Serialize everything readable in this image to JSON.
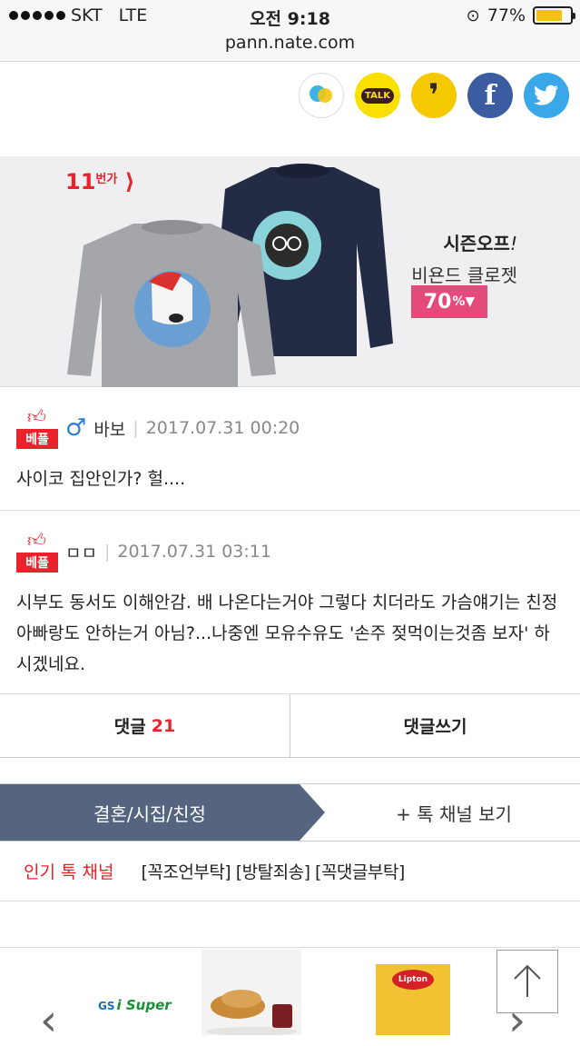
{
  "status_bar": {
    "carrier": "SKT",
    "network": "LTE",
    "time": "오전 9:18",
    "battery": "77%",
    "battery_level": 0.77,
    "url": "pann.nate.com"
  },
  "share_icons": [
    "kakaostory-icon",
    "kakaotalk-icon",
    "kakaopage-icon",
    "facebook-icon",
    "twitter-icon"
  ],
  "share": {
    "talk_label": "TALK",
    "kakaopage_glyph": "❜",
    "facebook_glyph": "f"
  },
  "ad": {
    "brand": "11",
    "brand_suffix": "번가",
    "title": "시즌오프",
    "title_mark": "!",
    "subtitle": "비욘드 클로젯",
    "discount": "70",
    "discount_unit": "%▼"
  },
  "comments": [
    {
      "badge": "베플",
      "gender_icon": "male-icon",
      "author": "바보",
      "date": "2017.07.31 00:20",
      "text": "사이코 집안인가? 헐...."
    },
    {
      "badge": "베플",
      "author": "ㅁㅁ",
      "date": "2017.07.31 03:11",
      "text": "시부도 동서도 이해안감. 배 나온다는거야 그렇다 치더라도 가슴얘기는 친정아빠랑도 안하는거 아님?...나중엔 모유수유도 '손주 젖먹이는것좀 보자' 하시겠네요."
    }
  ],
  "comment_buttons": {
    "comments_label": "댓글",
    "comments_count": "21",
    "write_label": "댓글쓰기"
  },
  "channel": {
    "current": "결혼/시집/친정",
    "more": "+ 톡 채널 보기"
  },
  "popular": {
    "label": "인기 톡 채널",
    "tags": "[꼭조언부탁] [방탈죄송] [꼭댓글부탁]"
  },
  "shop": {
    "gs_prefix": "GS",
    "gs_name": "i Super",
    "tea_brand": "Lipton"
  },
  "colors": {
    "accent_red": "#e8232b",
    "channel_bg": "#55657f",
    "badge_pink": "#e54b7a"
  }
}
